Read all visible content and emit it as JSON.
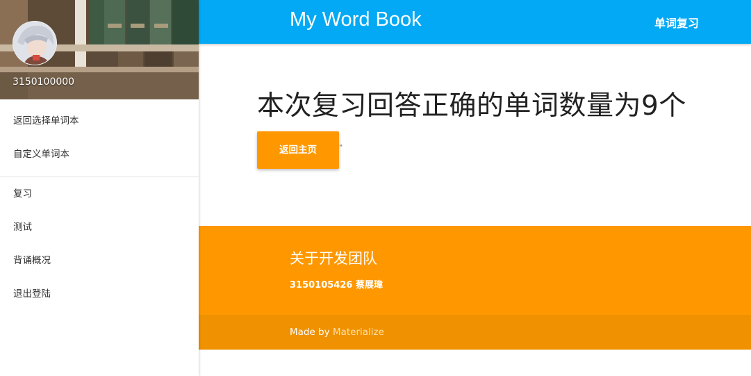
{
  "sidebar": {
    "user_id": "3150100000",
    "nav_primary": [
      {
        "label": "返回选择单词本"
      },
      {
        "label": "自定义单词本"
      }
    ],
    "nav_secondary": [
      {
        "label": "复习"
      },
      {
        "label": "测试"
      },
      {
        "label": "背诵概况"
      },
      {
        "label": "退出登陆"
      }
    ]
  },
  "header": {
    "brand": "My Word Book",
    "link": "单词复习",
    "color": "#03a9f4"
  },
  "main": {
    "result_title": "本次复习回答正确的单词数量为9个",
    "back_button_label": "返回主页",
    "stray_mark": "\"",
    "button_color": "#ff9800"
  },
  "footer": {
    "heading": "关于开发团队",
    "member": "3150105426 蔡展瑋",
    "made_by_prefix": "Made by ",
    "made_by_link": "Materialize",
    "color": "#ff9800"
  }
}
